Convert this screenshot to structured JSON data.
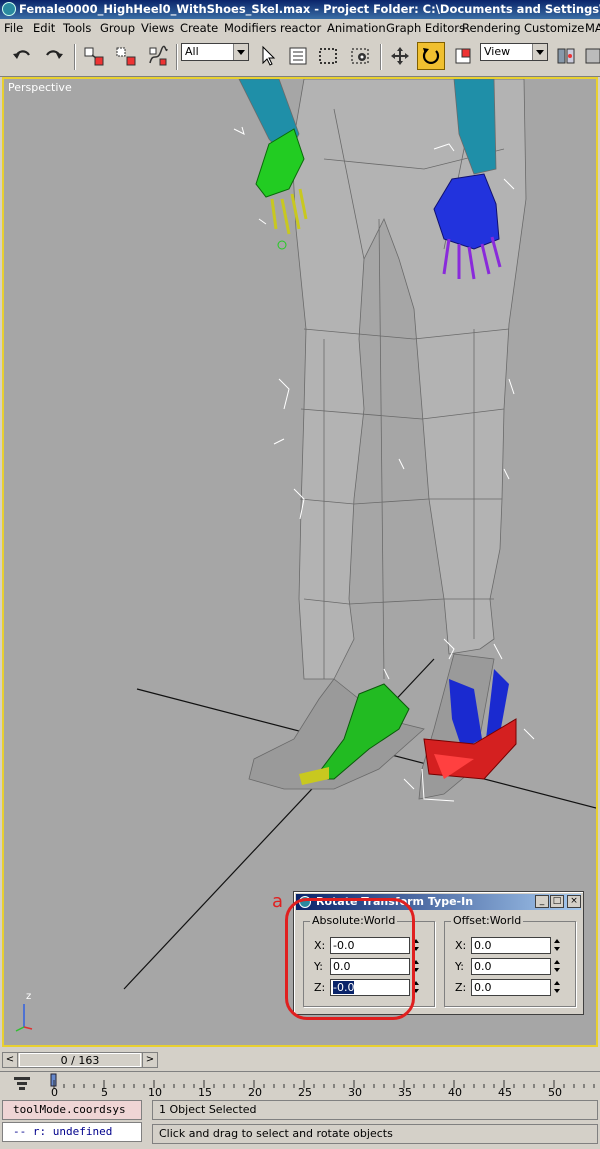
{
  "window": {
    "title": "Female0000_HighHeel0_WithShoes_Skel.max     - Project Folder: C:\\Documents and Settings\\hhsu\\My"
  },
  "menu": {
    "items": [
      "File",
      "Edit",
      "Tools",
      "Group",
      "Views",
      "Create",
      "Modifiers",
      "reactor",
      "Animation",
      "Graph Editors",
      "Rendering",
      "Customize",
      "MA"
    ]
  },
  "toolbar": {
    "selection_filter": "All",
    "reference_coord": "View"
  },
  "viewport": {
    "label": "Perspective",
    "axis_label": "z"
  },
  "annotation": {
    "label": "a",
    "color": "#e02020"
  },
  "rotate_dialog": {
    "title": "Rotate Transform Type-In",
    "absolute": {
      "label": "Absolute:World",
      "x_label": "X:",
      "x": "-0.0",
      "y_label": "Y:",
      "y": "0.0",
      "z_label": "Z:",
      "z": "-0.0"
    },
    "offset": {
      "label": "Offset:World",
      "x_label": "X:",
      "x": "0.0",
      "y_label": "Y:",
      "y": "0.0",
      "z_label": "Z:",
      "z": "0.0"
    }
  },
  "timeline": {
    "frame": "0 / 163",
    "prev": "<",
    "next": ">",
    "ticks": [
      "0",
      "5",
      "10",
      "15",
      "20",
      "25",
      "30",
      "35",
      "40",
      "45",
      "50"
    ]
  },
  "status": {
    "listener_top": "toolMode.coordsys",
    "listener_bottom": "--   r: undefined",
    "selection": "1 Object Selected",
    "prompt": "Click and drag to select and rotate objects"
  }
}
